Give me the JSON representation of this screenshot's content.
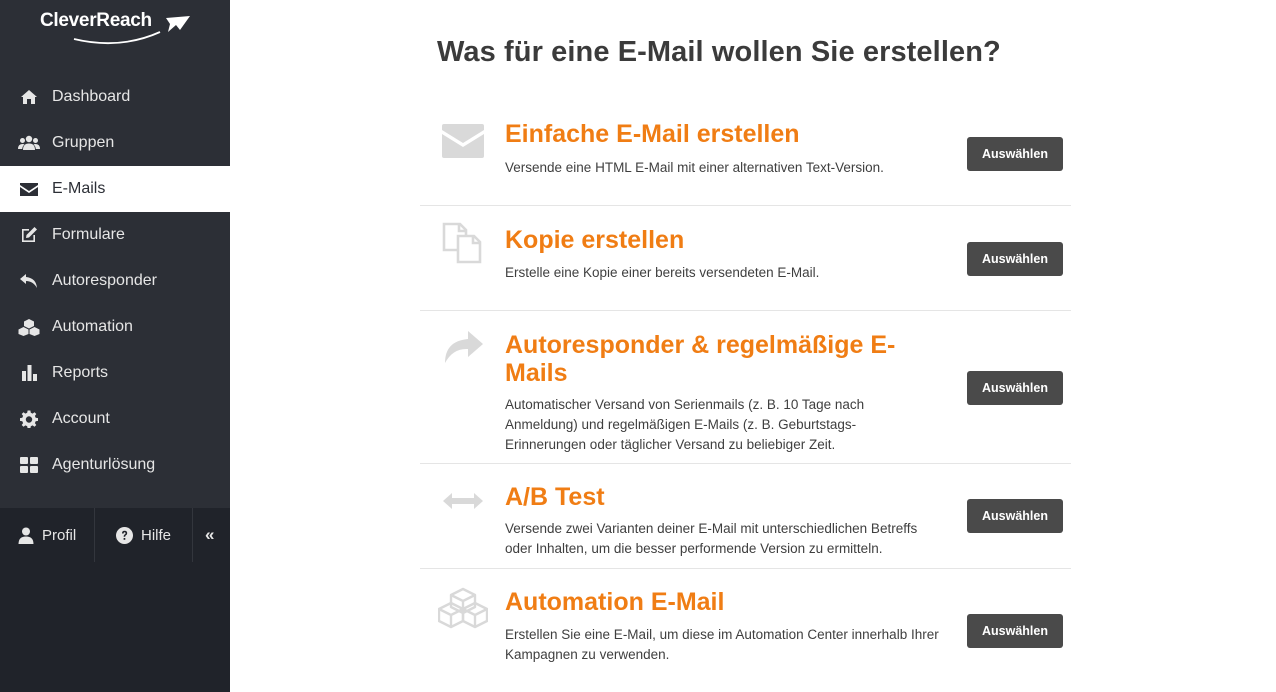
{
  "brand": {
    "name": "CleverReach"
  },
  "sidebar": {
    "items": [
      {
        "label": "Dashboard",
        "icon": "home-icon"
      },
      {
        "label": "Gruppen",
        "icon": "users-icon"
      },
      {
        "label": "E-Mails",
        "icon": "envelope-icon",
        "active": true
      },
      {
        "label": "Formulare",
        "icon": "edit-icon"
      },
      {
        "label": "Autoresponder",
        "icon": "reply-icon"
      },
      {
        "label": "Automation",
        "icon": "cubes-icon"
      },
      {
        "label": "Reports",
        "icon": "bar-chart-icon"
      },
      {
        "label": "Account",
        "icon": "gear-icon"
      },
      {
        "label": "Agenturlösung",
        "icon": "grid-icon"
      }
    ],
    "bottom": {
      "profil": "Profil",
      "hilfe": "Hilfe",
      "collapse": "«"
    }
  },
  "main": {
    "title": "Was für eine E-Mail wollen Sie erstellen?",
    "options": [
      {
        "title": "Einfache E-Mail erstellen",
        "description": "Versende eine HTML E-Mail mit einer alternativen Text-Version.",
        "button": "Auswählen",
        "icon": "envelope-icon"
      },
      {
        "title": "Kopie erstellen",
        "description": "Erstelle eine Kopie einer bereits versendeten E-Mail.",
        "button": "Auswählen",
        "icon": "copy-icon"
      },
      {
        "title": "Autoresponder & regelmäßige E-Mails",
        "description": "Automatischer Versand von Serienmails (z. B. 10 Tage nach Anmeldung) und regelmäßigen E-Mails (z. B. Geburtstags-Erinnerungen oder täglicher Versand zu beliebiger Zeit.",
        "button": "Auswählen",
        "icon": "share-arrow-icon"
      },
      {
        "title": "A/B Test",
        "description": "Versende zwei Varianten deiner E-Mail mit unterschiedlichen Betreffs oder Inhalten, um die besser performende Version zu ermitteln.",
        "button": "Auswählen",
        "icon": "arrows-horizontal-icon"
      },
      {
        "title": "Automation E-Mail",
        "description": "Erstellen Sie eine E-Mail, um diese im Automation Center innerhalb Ihrer Kampagnen zu verwenden.",
        "button": "Auswählen",
        "icon": "cubes-icon"
      }
    ]
  },
  "colors": {
    "sidebar_bg": "#2c2f36",
    "sidebar_bottom_bg": "#20232a",
    "accent_orange": "#f07d14",
    "button_bg": "#4a4a4a",
    "title_text": "#3b3b3b",
    "icon_grey": "#d9d9d9"
  }
}
